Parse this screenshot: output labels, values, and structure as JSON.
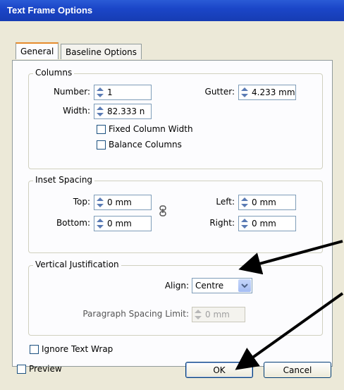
{
  "window": {
    "title": "Text Frame Options"
  },
  "tabs": [
    {
      "label": "General",
      "active": true
    },
    {
      "label": "Baseline Options",
      "active": false
    }
  ],
  "columns": {
    "group_label": "Columns",
    "number_label": "Number:",
    "number_value": "1",
    "gutter_label": "Gutter:",
    "gutter_value": "4.233 mm",
    "width_label": "Width:",
    "width_value": "82.333 n",
    "fixed_column_width_label": "Fixed Column Width",
    "fixed_column_width_checked": false,
    "balance_columns_label": "Balance Columns",
    "balance_columns_checked": false
  },
  "inset_spacing": {
    "group_label": "Inset Spacing",
    "top_label": "Top:",
    "top_value": "0 mm",
    "bottom_label": "Bottom:",
    "bottom_value": "0 mm",
    "left_label": "Left:",
    "left_value": "0 mm",
    "right_label": "Right:",
    "right_value": "0 mm"
  },
  "vertical_justification": {
    "group_label": "Vertical Justification",
    "align_label": "Align:",
    "align_value": "Centre",
    "paragraph_spacing_label": "Paragraph Spacing Limit:",
    "paragraph_spacing_value": "0 mm"
  },
  "ignore_text_wrap": {
    "label": "Ignore Text Wrap",
    "checked": false
  },
  "preview": {
    "label": "Preview",
    "checked": false
  },
  "buttons": {
    "ok": "OK",
    "cancel": "Cancel"
  },
  "icons": {
    "spinner": "spinner-arrows-icon",
    "link": "chain-link-icon",
    "dropdown": "chevron-down-icon"
  },
  "colors": {
    "title_bar": "#1b46c8",
    "dialog_bg": "#ece9d8",
    "tab_accent": "#e68b2c"
  }
}
